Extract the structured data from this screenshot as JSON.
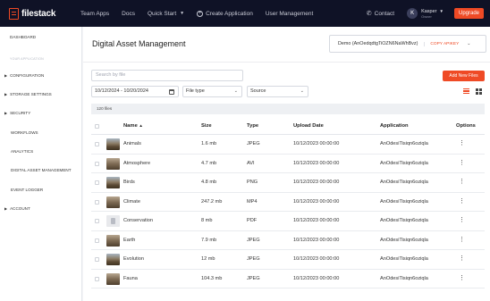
{
  "topbar": {
    "logo_text": "filestack",
    "nav": [
      {
        "label": "Team Apps"
      },
      {
        "label": "Docs"
      },
      {
        "label": "Quick Start"
      },
      {
        "label": "Create Application"
      },
      {
        "label": "User Management"
      }
    ],
    "contact_label": "Contact",
    "user_initial": "K",
    "user_name": "Kasper",
    "user_role": "Owner",
    "upgrade_label": "Upgrade"
  },
  "sidebar": {
    "dashboard": "DASHBOARD",
    "section_label": "YOUR APPLICATION",
    "items": [
      {
        "label": "CONFIGURATION"
      },
      {
        "label": "STORAGE SETTINGS"
      },
      {
        "label": "SECURITY"
      },
      {
        "label": "WORKFLOWS"
      },
      {
        "label": "ANALYTICS"
      },
      {
        "label": "DIGITAL ASSET MANAGEMENT"
      },
      {
        "label": "EVENT LOGGER"
      },
      {
        "label": "ACCOUNT"
      }
    ]
  },
  "main": {
    "title": "Digital Asset Management",
    "app_select": "Demo (AnOedqdtgTiOZN6NaWhBvz)",
    "copy_key": "COPY APIKEY",
    "search_placeholder": "Search by file",
    "add_button": "Add New Files",
    "date_range": "10/12/2024 - 10/20/2024",
    "file_type_label": "File type",
    "source_label": "Source",
    "file_count": "120 files",
    "columns": {
      "name": "Name",
      "sort_arrow": "▲",
      "size": "Size",
      "type": "Type",
      "upload_date": "Upload Date",
      "application": "Application",
      "options": "Options"
    },
    "rows": [
      {
        "name": "Animals",
        "size": "1.6 mb",
        "type": "JPEG",
        "date": "10/12/2023 00:00:00",
        "app": "AnOdesiTisiqn6oziqla",
        "thumb": "image"
      },
      {
        "name": "Atmosphere",
        "size": "4.7 mb",
        "type": "AVI",
        "date": "10/12/2023 00:00:00",
        "app": "AnOdesiTisiqn6oziqla",
        "thumb": "image"
      },
      {
        "name": "Birds",
        "size": "4.8 mb",
        "type": "PNG",
        "date": "10/12/2023 00:00:00",
        "app": "AnOdesiTisiqn6oziqla",
        "thumb": "image"
      },
      {
        "name": "Climate",
        "size": "247.2 mb",
        "type": "MP4",
        "date": "10/12/2023 00:00:00",
        "app": "AnOdesiTisiqn6oziqla",
        "thumb": "image"
      },
      {
        "name": "Conservation",
        "size": "8 mb",
        "type": "PDF",
        "date": "10/12/2023 00:00:00",
        "app": "AnOdesiTisiqn6oziqla",
        "thumb": "document"
      },
      {
        "name": "Earth",
        "size": "7.9 mb",
        "type": "JPEG",
        "date": "10/12/2023 00:00:00",
        "app": "AnOdesiTisiqn6oziqla",
        "thumb": "image"
      },
      {
        "name": "Evolution",
        "size": "12 mb",
        "type": "JPEG",
        "date": "10/12/2023 00:00:00",
        "app": "AnOdesiTisiqn6oziqla",
        "thumb": "image"
      },
      {
        "name": "Fauna",
        "size": "104.3 mb",
        "type": "JPEG",
        "date": "10/12/2023 00:00:00",
        "app": "AnOdesiTisiqn6oziqla",
        "thumb": "image"
      }
    ]
  },
  "icons": {
    "phone": "phone-icon",
    "calendar": "calendar-icon",
    "kebab": "kebab-menu-icon",
    "list_view": "list-view-icon",
    "grid_view": "grid-view-icon"
  },
  "colors": {
    "accent": "#ef4a25",
    "topbar": "#0f1226"
  }
}
